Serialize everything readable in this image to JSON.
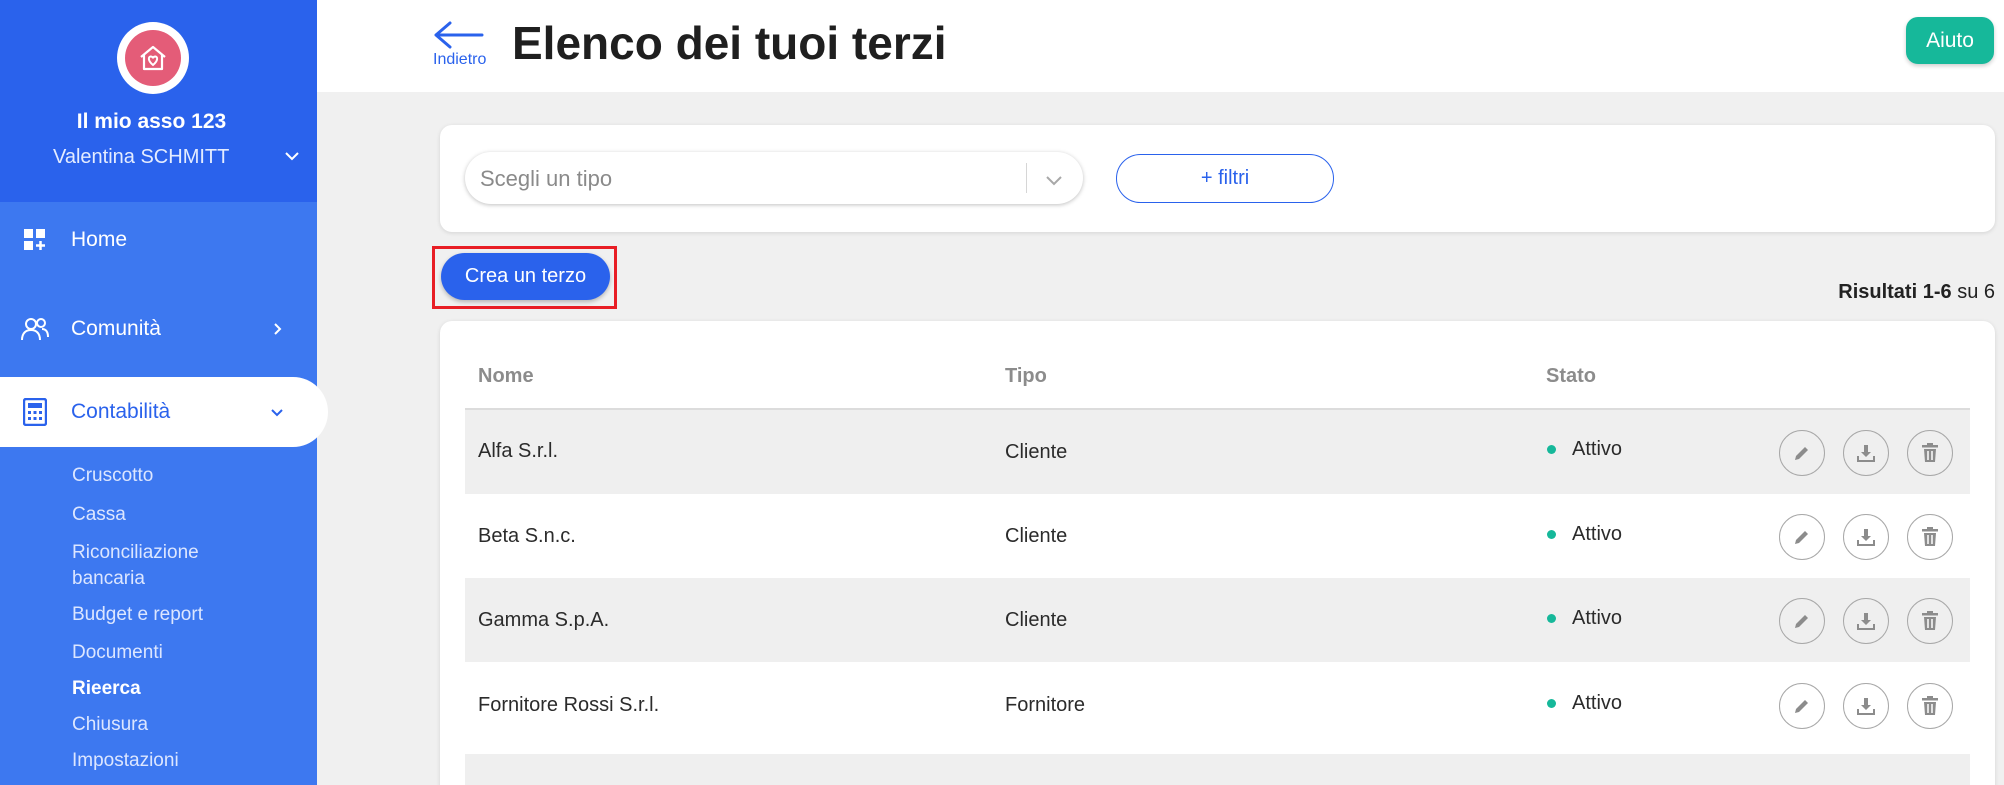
{
  "sidebar": {
    "org_name": "Il mio asso 123",
    "user_name": "Valentina SCHMITT",
    "nav": [
      {
        "label": "Home",
        "icon": "dashboard-icon"
      },
      {
        "label": "Comunità",
        "icon": "people-icon"
      },
      {
        "label": "Contabilità",
        "icon": "calculator-icon"
      }
    ],
    "subnav": [
      "Cruscotto",
      "Cassa",
      "Riconciliazione bancaria",
      "Budget e report",
      "Documenti",
      "Rieerca",
      "Chiusura",
      "Impostazioni"
    ]
  },
  "header": {
    "back_label": "Indietro",
    "title": "Elenco dei tuoi terzi",
    "help_label": "Aiuto"
  },
  "filters": {
    "type_placeholder": "Scegli un tipo",
    "more_filters_label": "+ filtri"
  },
  "toolbar": {
    "create_label": "Crea un terzo",
    "results_prefix": "Risultati",
    "results_range": "1-6",
    "results_suffix": "su 6"
  },
  "table": {
    "columns": [
      "Nome",
      "Tipo",
      "Stato"
    ],
    "rows": [
      {
        "name": "Alfa S.r.l.",
        "type": "Cliente",
        "status": "Attivo"
      },
      {
        "name": "Beta S.n.c.",
        "type": "Cliente",
        "status": "Attivo"
      },
      {
        "name": "Gamma S.p.A.",
        "type": "Cliente",
        "status": "Attivo"
      },
      {
        "name": "Fornitore Rossi S.r.l.",
        "type": "Fornitore",
        "status": "Attivo"
      }
    ]
  },
  "colors": {
    "primary": "#2a62ec",
    "sidebar": "#3d78f0",
    "accent": "#16b89a",
    "highlight": "#e81e25"
  }
}
